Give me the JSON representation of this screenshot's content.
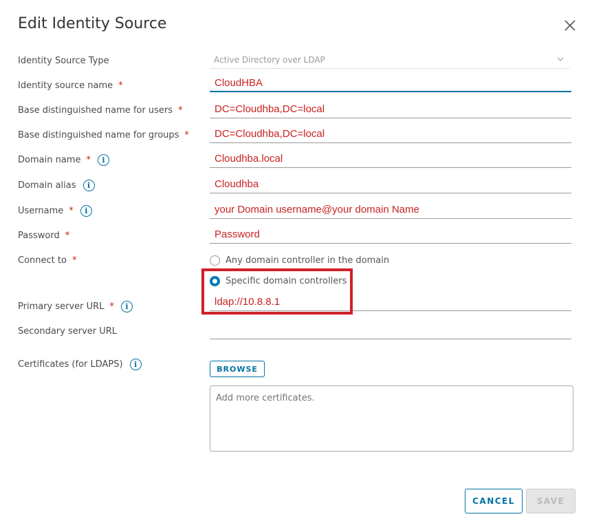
{
  "dialog": {
    "title": "Edit Identity Source"
  },
  "form": {
    "identity_source_type": {
      "label": "Identity Source Type",
      "value": "Active Directory over LDAP"
    },
    "identity_source_name": {
      "label": "Identity source name",
      "value": "CloudHBA"
    },
    "base_dn_users": {
      "label": "Base distinguished name for users",
      "value": "DC=Cloudhba,DC=local"
    },
    "base_dn_groups": {
      "label": "Base distinguished name for groups",
      "value": "DC=Cloudhba,DC=local"
    },
    "domain_name": {
      "label": "Domain name",
      "value": "Cloudhba.local"
    },
    "domain_alias": {
      "label": "Domain alias",
      "value": "Cloudhba"
    },
    "username": {
      "label": "Username",
      "value": "your Domain username@your domain Name"
    },
    "password": {
      "label": "Password",
      "value": "Password"
    },
    "connect_to": {
      "label": "Connect to",
      "options": [
        {
          "label": "Any domain controller in the domain",
          "checked": false
        },
        {
          "label": "Specific domain controllers",
          "checked": true
        }
      ]
    },
    "primary_server_url": {
      "label": "Primary server URL",
      "value": "ldap://10.8.8.1"
    },
    "secondary_server_url": {
      "label": "Secondary server URL",
      "value": ""
    },
    "certificates": {
      "label": "Certificates (for LDAPS)",
      "browse_label": "BROWSE",
      "placeholder": "Add more certificates."
    }
  },
  "footer": {
    "cancel_label": "CANCEL",
    "save_label": "SAVE"
  },
  "colors": {
    "accent": "#0072a3",
    "required": "#c92100",
    "annotation": "#d0202a",
    "value_text": "#c92121"
  }
}
